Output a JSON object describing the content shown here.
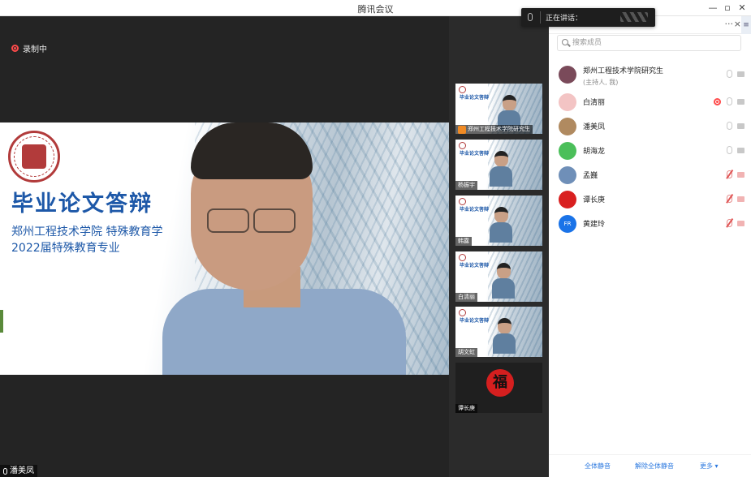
{
  "window": {
    "title": "腾讯会议"
  },
  "recording": {
    "label": "录制中"
  },
  "slide": {
    "title": "毕业论文答辩",
    "subtitle1": "郑州工程技术学院  特殊教育学",
    "subtitle2": "2022届特殊教育专业"
  },
  "main_speaker": {
    "name": "潘美凤"
  },
  "thumbnails": [
    {
      "name": "郑州工程技术学院研究生",
      "mini_title": "毕业论文答辩",
      "host": true
    },
    {
      "name": "杨振宇",
      "mini_title": "毕业论文答辩",
      "host": false
    },
    {
      "name": "韩露",
      "mini_title": "毕业论文答辩",
      "host": false
    },
    {
      "name": "白清丽",
      "mini_title": "毕业论文答辩",
      "host": false
    },
    {
      "name": "胡文虹",
      "mini_title": "毕业论文答辩",
      "host": false
    },
    {
      "name": "谭长庚",
      "mini_title": "",
      "host": false,
      "avatar_glyph": "福"
    }
  ],
  "speaking_popup": {
    "text": "正在讲话："
  },
  "panel": {
    "more_label": "···",
    "close_label": "×",
    "search_placeholder": "搜索成员",
    "participants": [
      {
        "name": "郑州工程技术学院研究生",
        "role": "(主持人, 我)",
        "avatar_color": "#7a4a5a",
        "mic": "on",
        "cam": "on"
      },
      {
        "name": "白清丽",
        "role": "",
        "avatar_color": "#f3c4c4",
        "mic": "on",
        "cam": "on",
        "recording": true
      },
      {
        "name": "潘美凤",
        "role": "",
        "avatar_color": "#b08a60",
        "mic": "on",
        "cam": "on"
      },
      {
        "name": "胡海龙",
        "role": "",
        "avatar_color": "#4bbf5a",
        "mic": "on",
        "cam": "on"
      },
      {
        "name": "孟巍",
        "role": "",
        "avatar_color": "#6f8fb8",
        "mic": "off",
        "cam": "off"
      },
      {
        "name": "谭长庚",
        "role": "",
        "avatar_color": "#d92020",
        "mic": "off",
        "cam": "off"
      },
      {
        "name": "黄建玲",
        "role": "",
        "avatar_color": "#1a73e8",
        "mic": "off",
        "cam": "off",
        "avatar_text": "FR"
      }
    ],
    "footer": {
      "mute_all": "全体静音",
      "unmute_all": "解除全体静音",
      "more": "更多 ▾"
    }
  },
  "window_controls": {
    "minimize": "—",
    "maximize": "▫",
    "close": "✕"
  }
}
